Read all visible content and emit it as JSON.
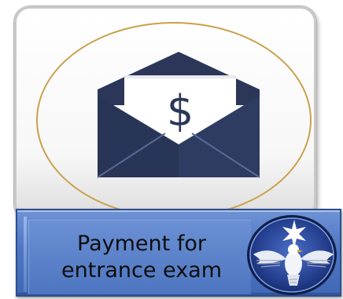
{
  "tile": {
    "icon": "envelope-money-icon",
    "symbol": "$",
    "ring_color": "#caa14a",
    "envelope_color": "#2e3a5c"
  },
  "caption": {
    "line1": "Payment for",
    "line2": "entrance exam",
    "bar_color": "#4f76c2"
  },
  "emblem": {
    "icon": "eagle-seal-icon",
    "ring_color": "#2b4fa8"
  }
}
